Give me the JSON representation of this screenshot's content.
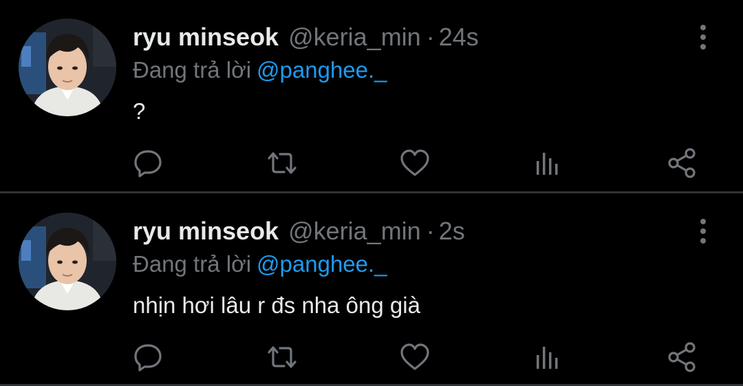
{
  "tweets": [
    {
      "display_name": "ryu minseok",
      "handle": "@keria_min",
      "separator": "·",
      "time": "24s",
      "reply_prefix": "Đang trả lời",
      "reply_to": "@panghee._",
      "text": "?"
    },
    {
      "display_name": "ryu minseok",
      "handle": "@keria_min",
      "separator": "·",
      "time": "2s",
      "reply_prefix": "Đang trả lời",
      "reply_to": "@panghee._",
      "text": "nhịn hơi lâu r đs nha ông già"
    }
  ],
  "icons": {
    "more": "vertical-ellipsis-icon",
    "reply": "speech-bubble-icon",
    "retweet": "retweet-arrows-icon",
    "like": "heart-icon",
    "views": "bar-chart-icon",
    "share": "share-nodes-icon"
  },
  "colors": {
    "background": "#000000",
    "primary_text": "#e7e9ea",
    "secondary_text": "#71767b",
    "mention": "#1d9bf0",
    "divider": "#2f3336"
  }
}
